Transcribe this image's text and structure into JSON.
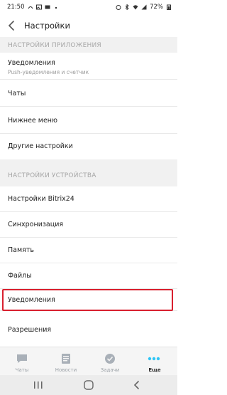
{
  "status_bar": {
    "time": "21:50",
    "battery": "72%",
    "icons": [
      "wifi-calling-icon",
      "image-icon",
      "mail-icon",
      "dot-icon",
      "alarm-icon",
      "bluetooth-icon",
      "wifi-icon",
      "signal-icon",
      "battery-icon"
    ]
  },
  "header": {
    "title": "Настройки"
  },
  "sections": {
    "app": {
      "title": "НАСТРОЙКИ ПРИЛОЖЕНИЯ",
      "items": [
        {
          "label": "Уведомления",
          "sub": "Push-уведомления и счетчик"
        },
        {
          "label": "Чаты"
        },
        {
          "label": "Нижнее меню"
        },
        {
          "label": "Другие настройки"
        }
      ]
    },
    "device": {
      "title": "НАСТРОЙКИ УСТРОЙСТВА",
      "items": [
        {
          "label": "Настройки Bitrix24"
        },
        {
          "label": "Синхронизация"
        },
        {
          "label": "Память"
        },
        {
          "label": "Файлы"
        },
        {
          "label": "Уведомления"
        },
        {
          "label": "Разрешения"
        }
      ]
    }
  },
  "tabbar": {
    "tabs": [
      {
        "label": "Чаты",
        "icon": "chat-icon"
      },
      {
        "label": "Новости",
        "icon": "news-icon"
      },
      {
        "label": "Задачи",
        "icon": "tasks-icon"
      },
      {
        "label": "Еще",
        "icon": "more-icon"
      }
    ]
  },
  "colors": {
    "accent": "#2fc6f6",
    "highlight": "#d8202f",
    "section_bg": "#f1f1f1"
  }
}
